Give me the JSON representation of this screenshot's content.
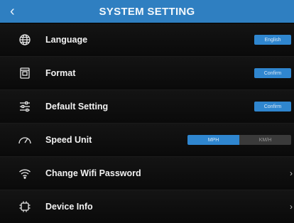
{
  "header": {
    "back_icon": "chevron-left-icon",
    "title": "SYSTEM SETTING"
  },
  "colors": {
    "accent": "#2f86cf",
    "header_bg": "#2f7fc1",
    "background": "#000000"
  },
  "rows": [
    {
      "icon": "globe-icon",
      "label": "Language",
      "control": "button",
      "button_label": "English"
    },
    {
      "icon": "format-icon",
      "label": "Format",
      "control": "button",
      "button_label": "Confirm"
    },
    {
      "icon": "sliders-icon",
      "label": "Default Setting",
      "control": "button",
      "button_label": "Confirm"
    },
    {
      "icon": "speedometer-icon",
      "label": "Speed Unit",
      "control": "segmented",
      "options": [
        "MPH",
        "KM/H"
      ],
      "selected": "MPH"
    },
    {
      "icon": "wifi-icon",
      "label": "Change Wifi Password",
      "control": "chevron"
    },
    {
      "icon": "chip-icon",
      "label": "Device Info",
      "control": "chevron"
    }
  ]
}
